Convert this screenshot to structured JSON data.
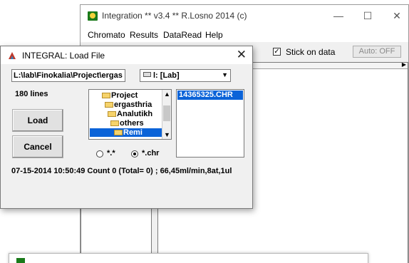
{
  "main_window": {
    "title": "Integration ** v3.4 ** R.Losno 2014 (c)",
    "minimize": "—",
    "maximize": "☐",
    "close": "✕",
    "menu": [
      "Chromato",
      "Results",
      "DataRead",
      "Help"
    ],
    "stick_on_data_label": "Stick on data",
    "stick_on_data_checked": true,
    "auto_button": "Auto: OFF"
  },
  "dialog": {
    "title": "INTEGRAL: Load File",
    "close": "✕",
    "path": "L:\\lab\\Finokalia\\Project\\ergas",
    "drive": "l: [Lab]",
    "lines_count": "180 lines",
    "load_button": "Load",
    "cancel_button": "Cancel",
    "directories": [
      "Project",
      "ergasthria",
      "Analutikh",
      "others",
      "Remi"
    ],
    "selected_directory": "Remi",
    "files": [
      "14365325.CHR"
    ],
    "selected_file": "14365325.CHR",
    "filters": [
      "*.*",
      "*.chr"
    ],
    "selected_filter": "*.chr",
    "status": "07-15-2014 10:50:49 Count 0 (Total= 0) ; 66,45ml/min,8at,1ul"
  },
  "colors": {
    "selection": "#0b63d8",
    "app_icon": "#1a7a1a"
  }
}
